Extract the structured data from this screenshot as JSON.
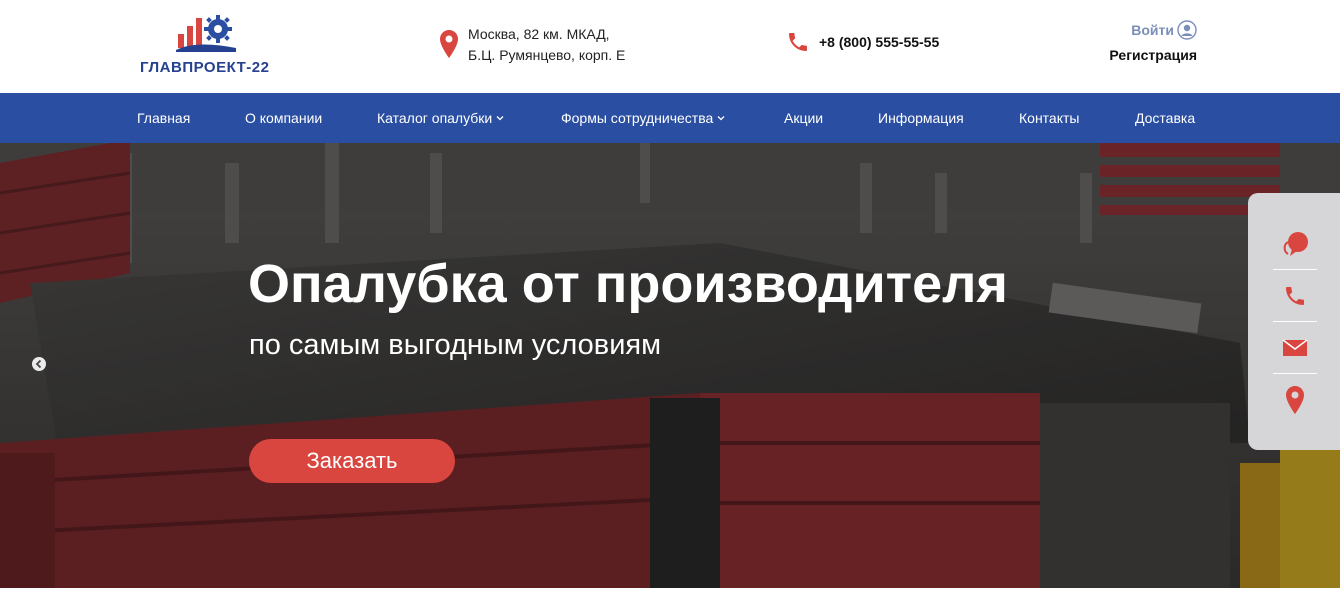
{
  "brand": {
    "name": "ГЛАВПРОЕКТ-22",
    "color": "#26418f",
    "accent": "#d9463f"
  },
  "header": {
    "address_line1": "Москва, 82 км. МКАД,",
    "address_line2": "Б.Ц. Румянцево, корп. Е",
    "phone": "+8 (800) 555-55-55",
    "login_label": "Войти",
    "register_label": "Регистрация"
  },
  "nav": {
    "color": "#2a4ea2",
    "items": [
      {
        "label": "Главная",
        "has_dropdown": false
      },
      {
        "label": "О компании",
        "has_dropdown": false
      },
      {
        "label": "Каталог опалубки",
        "has_dropdown": true
      },
      {
        "label": "Формы сотрудничества",
        "has_dropdown": true
      },
      {
        "label": "Акции",
        "has_dropdown": false
      },
      {
        "label": "Информация",
        "has_dropdown": false
      },
      {
        "label": "Контакты",
        "has_dropdown": false
      },
      {
        "label": "Доставка",
        "has_dropdown": false
      }
    ]
  },
  "hero": {
    "title": "Опалубка от производителя",
    "subtitle": "по самым выгодным условиям",
    "cta_label": "Заказать"
  },
  "side_widget": {
    "icons": [
      "chat-icon",
      "phone-icon",
      "mail-icon",
      "location-pin-icon"
    ]
  }
}
